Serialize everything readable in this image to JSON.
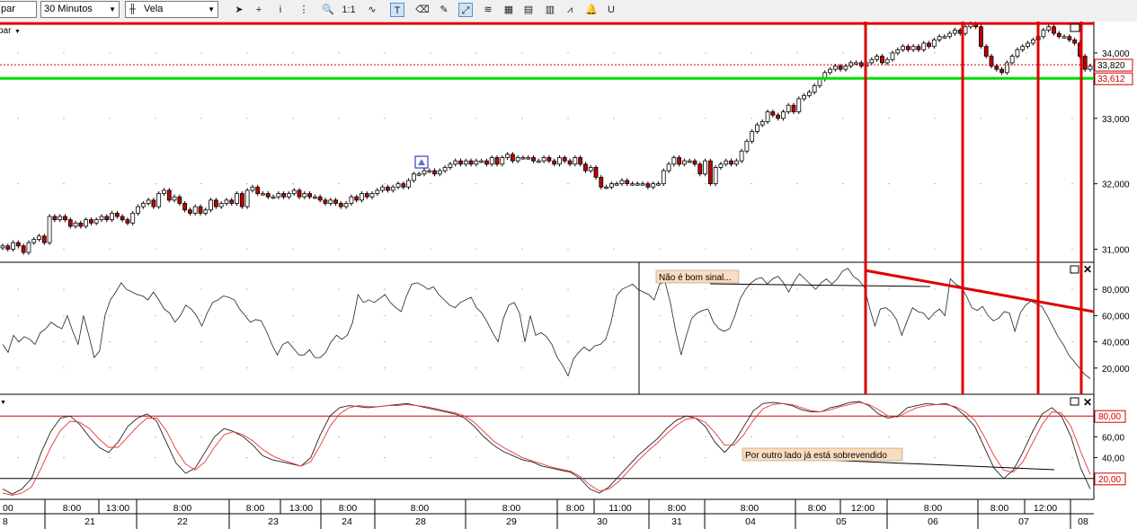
{
  "toolbar": {
    "symbol_value": "par",
    "interval_value": "30 Minutos",
    "chart_type_value": "Vela",
    "buttons": [
      {
        "name": "cursor-arrow-button",
        "glyph": "➤",
        "active": false
      },
      {
        "name": "crosshair-button",
        "glyph": "+",
        "active": false
      },
      {
        "name": "info-button",
        "glyph": "i",
        "active": false
      },
      {
        "name": "grid-button",
        "glyph": "⋮",
        "active": false
      },
      {
        "name": "zoom-button",
        "glyph": "🔍",
        "active": false
      },
      {
        "name": "zoom-1to1-button",
        "glyph": "1:1",
        "active": false
      },
      {
        "name": "indicator-button",
        "glyph": "∿",
        "active": false
      },
      {
        "name": "text-tool-button",
        "glyph": "T",
        "active": true
      },
      {
        "name": "eraser-button",
        "glyph": "⌫",
        "active": false
      },
      {
        "name": "draw-tool-button",
        "glyph": "✎",
        "active": false
      },
      {
        "name": "trendline-tool-button",
        "glyph": "⤢",
        "active": true
      },
      {
        "name": "fibonacci-button",
        "glyph": "≋",
        "active": false
      },
      {
        "name": "template-button",
        "glyph": "▦",
        "active": false
      },
      {
        "name": "compare-button",
        "glyph": "▤",
        "active": false
      },
      {
        "name": "layout-button",
        "glyph": "▥",
        "active": false
      },
      {
        "name": "wave-button",
        "glyph": "⩘",
        "active": false
      },
      {
        "name": "alert-bell-button",
        "glyph": "🔔",
        "active": false
      },
      {
        "name": "magnet-button",
        "glyph": "U",
        "active": false
      }
    ]
  },
  "price_panel": {
    "y_ticks": [
      "34,000",
      "33,000",
      "32,000",
      "31,000"
    ],
    "tick_values": [
      34000,
      33000,
      32000,
      31000
    ],
    "ylim": [
      30800,
      34480
    ],
    "last_price_label": "33,820",
    "last_price": 33820,
    "support_label": "33,612",
    "support": 33612,
    "resistance": 34450,
    "top_left_label": "par"
  },
  "rsi_panel": {
    "y_ticks": [
      "80,000",
      "60,000",
      "40,000",
      "20,000"
    ],
    "tick_values": [
      80,
      60,
      40,
      20
    ],
    "ylim": [
      0,
      100
    ],
    "annotation": "Não é bom sinal..."
  },
  "stoch_panel": {
    "y_ticks": [
      "60,00",
      "40,00"
    ],
    "tick_values": [
      60,
      40
    ],
    "upper_label": "80,00",
    "upper_level": 80,
    "lower_label": "20,00",
    "lower_level": 20,
    "ylim": [
      0,
      100
    ],
    "annotation": "Por outro lado já está sobrevendido"
  },
  "time_axis": {
    "upper_labels": [
      "00",
      "8:00",
      "13:00",
      "8:00",
      "8:00",
      "13:00",
      "8:00",
      "8:00",
      "8:00",
      "8:00",
      "11:00",
      "8:00",
      "8:00",
      "8:00",
      "12:00",
      "8:00",
      "8:00",
      "12:00"
    ],
    "lower_labels": [
      "8",
      "21",
      "22",
      "23",
      "24",
      "28",
      "29",
      "30",
      "31",
      "04",
      "05",
      "06",
      "07",
      "08"
    ]
  },
  "colors": {
    "up_candle": "#ffffff",
    "down_candle": "#c00000",
    "candle_outline": "#000000",
    "support_line": "#00dd00",
    "resistance_line": "#dd0000",
    "annotation_line": "#dd0000",
    "stoch_signal": "#ee3333",
    "label_bg": "#fadcc0"
  },
  "chart_data": [
    {
      "type": "candlestick",
      "title": "",
      "ylim": [
        30800,
        34480
      ],
      "close": [
        31050,
        31000,
        31100,
        31050,
        30950,
        31100,
        31150,
        31200,
        31100,
        31500,
        31450,
        31500,
        31450,
        31350,
        31400,
        31350,
        31450,
        31400,
        31450,
        31500,
        31450,
        31550,
        31500,
        31450,
        31400,
        31550,
        31650,
        31700,
        31750,
        31650,
        31850,
        31900,
        31750,
        31800,
        31700,
        31600,
        31550,
        31650,
        31550,
        31600,
        31750,
        31650,
        31700,
        31750,
        31700,
        31850,
        31650,
        31900,
        31950,
        31850,
        31850,
        31800,
        31800,
        31850,
        31800,
        31850,
        31900,
        31800,
        31850,
        31800,
        31800,
        31750,
        31700,
        31750,
        31700,
        31650,
        31700,
        31800,
        31750,
        31850,
        31800,
        31850,
        31900,
        31950,
        31900,
        31950,
        32000,
        31950,
        32050,
        32150,
        32150,
        32200,
        32200,
        32150,
        32200,
        32250,
        32300,
        32350,
        32300,
        32350,
        32300,
        32350,
        32350,
        32300,
        32400,
        32300,
        32400,
        32450,
        32350,
        32400,
        32400,
        32400,
        32350,
        32350,
        32400,
        32350,
        32300,
        32400,
        32350,
        32300,
        32400,
        32300,
        32200,
        32250,
        32100,
        31950,
        31950,
        32000,
        32000,
        32050,
        32000,
        32000,
        32000,
        32000,
        31950,
        32000,
        32000,
        32200,
        32300,
        32400,
        32300,
        32350,
        32350,
        32300,
        32150,
        32350,
        32000,
        32250,
        32300,
        32350,
        32300,
        32350,
        32500,
        32650,
        32800,
        32900,
        32950,
        33100,
        33050,
        33000,
        33100,
        33200,
        33100,
        33300,
        33350,
        33400,
        33500,
        33600,
        33700,
        33750,
        33800,
        33750,
        33800,
        33850,
        33850,
        33800,
        33850,
        33900,
        33950,
        33850,
        33900,
        34000,
        34050,
        34100,
        34050,
        34100,
        34050,
        34150,
        34100,
        34200,
        34250,
        34250,
        34300,
        34350,
        34300,
        34400,
        34450,
        34400,
        34100,
        33950,
        33800,
        33750,
        33700,
        33850,
        33950,
        34050,
        34100,
        34150,
        34200,
        34250,
        34350,
        34400,
        34300,
        34250,
        34250,
        34200,
        34150,
        33950,
        33750,
        33800
      ]
    },
    {
      "type": "line",
      "title": "",
      "ylim": [
        0,
        100
      ],
      "series": [
        {
          "values": [
            38,
            32,
            45,
            40,
            44,
            42,
            38,
            47,
            50,
            55,
            52,
            50,
            60,
            48,
            38,
            60,
            45,
            28,
            33,
            60,
            72,
            78,
            85,
            80,
            78,
            76,
            75,
            72,
            78,
            72,
            65,
            62,
            55,
            60,
            68,
            65,
            60,
            52,
            62,
            70,
            72,
            75,
            74,
            72,
            65,
            60,
            55,
            57,
            56,
            48,
            38,
            30,
            38,
            40,
            35,
            30,
            30,
            34,
            28,
            28,
            32,
            40,
            45,
            42,
            45,
            55,
            76,
            70,
            72,
            70,
            73,
            76,
            70,
            66,
            63,
            75,
            84,
            85,
            83,
            80,
            82,
            76,
            72,
            68,
            66,
            70,
            72,
            74,
            66,
            62,
            55,
            47,
            40,
            58,
            68,
            70,
            62,
            40,
            60,
            45,
            47,
            44,
            38,
            28,
            22,
            14,
            27,
            32,
            36,
            33,
            37,
            38,
            42,
            55,
            75,
            80,
            82,
            84,
            80,
            78,
            76,
            72,
            84,
            86,
            70,
            48,
            30,
            45,
            58,
            62,
            64,
            65,
            55,
            50,
            48,
            50,
            60,
            73,
            80,
            85,
            88,
            89,
            84,
            88,
            90,
            85,
            78,
            86,
            92,
            88,
            84,
            80,
            85,
            88,
            84,
            88,
            94,
            96,
            90,
            87,
            82,
            66,
            52,
            65,
            66,
            63,
            57,
            45,
            56,
            66,
            63,
            62,
            57,
            62,
            65,
            60,
            88,
            84,
            82,
            75,
            66,
            64,
            67,
            60,
            56,
            58,
            63,
            62,
            48,
            62,
            68,
            71,
            69,
            67,
            60,
            52,
            44,
            38,
            30,
            25,
            20,
            15,
            12
          ]
        }
      ]
    },
    {
      "type": "line",
      "title": "",
      "ylim": [
        0,
        100
      ],
      "series": [
        {
          "values": [
            10,
            5,
            10,
            20,
            45,
            65,
            78,
            80,
            72,
            60,
            50,
            45,
            55,
            70,
            78,
            82,
            75,
            55,
            35,
            25,
            30,
            45,
            60,
            68,
            65,
            60,
            52,
            42,
            38,
            36,
            34,
            32,
            40,
            62,
            80,
            88,
            90,
            89,
            88,
            89,
            90,
            91,
            92,
            90,
            88,
            86,
            84,
            82,
            78,
            70,
            60,
            52,
            46,
            42,
            38,
            36,
            32,
            30,
            28,
            26,
            20,
            10,
            6,
            12,
            22,
            32,
            42,
            50,
            58,
            68,
            76,
            80,
            78,
            70,
            55,
            45,
            55,
            70,
            85,
            92,
            93,
            92,
            90,
            86,
            84,
            84,
            88,
            90,
            93,
            94,
            90,
            82,
            78,
            80,
            88,
            90,
            92,
            91,
            92,
            88,
            80,
            70,
            50,
            30,
            20,
            28,
            45,
            65,
            82,
            88,
            80,
            60,
            30,
            10
          ]
        },
        {
          "values": [
            6,
            4,
            6,
            12,
            30,
            50,
            66,
            75,
            74,
            68,
            58,
            50,
            50,
            60,
            70,
            78,
            78,
            66,
            48,
            34,
            28,
            36,
            50,
            62,
            65,
            62,
            56,
            48,
            42,
            38,
            35,
            32,
            36,
            52,
            70,
            82,
            88,
            90,
            89,
            89,
            90,
            90,
            91,
            90,
            89,
            87,
            85,
            83,
            80,
            74,
            65,
            56,
            50,
            45,
            40,
            37,
            34,
            31,
            29,
            27,
            22,
            14,
            8,
            10,
            17,
            27,
            37,
            46,
            54,
            63,
            71,
            77,
            78,
            74,
            64,
            52,
            52,
            62,
            76,
            87,
            91,
            92,
            91,
            88,
            85,
            84,
            86,
            89,
            91,
            93,
            91,
            86,
            80,
            79,
            84,
            88,
            90,
            91,
            91,
            89,
            84,
            76,
            60,
            42,
            28,
            26,
            36,
            54,
            72,
            84,
            83,
            70,
            46,
            24
          ]
        }
      ]
    }
  ]
}
